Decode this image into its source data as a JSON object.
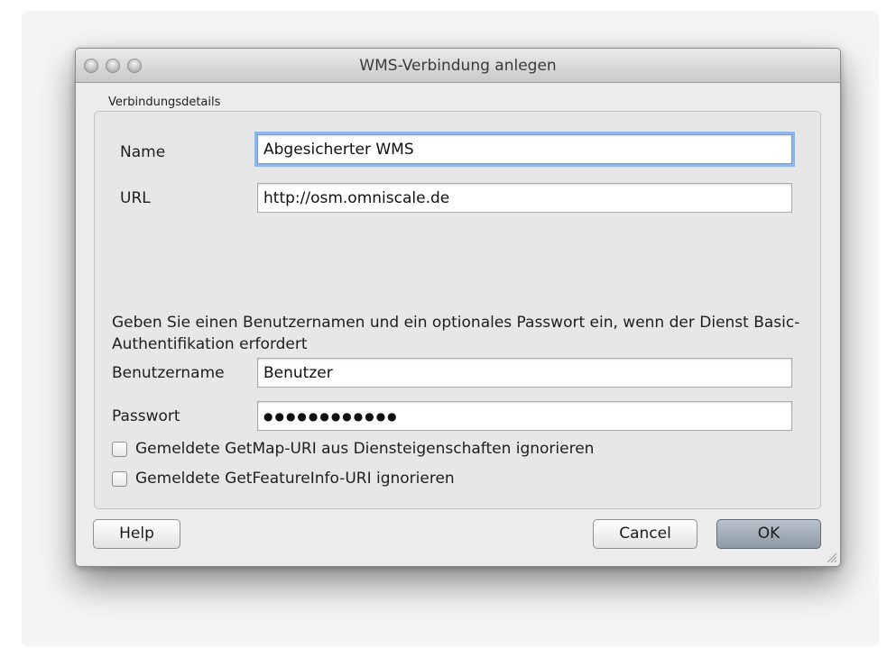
{
  "window": {
    "title": "WMS-Verbindung anlegen"
  },
  "group": {
    "label": "Verbindungsdetails"
  },
  "fields": {
    "name": {
      "label": "Name",
      "value": "Abgesicherter WMS"
    },
    "url": {
      "label": "URL",
      "value": "http://osm.omniscale.de"
    },
    "username": {
      "label": "Benutzername",
      "value": "Benutzer"
    },
    "password": {
      "label": "Passwort",
      "value": "●●●●●●●●●●●●"
    }
  },
  "info_text": "Geben Sie einen Benutzernamen und ein optionales Passwort ein, wenn der Dienst Basic-Authentifikation erfordert",
  "checkboxes": [
    {
      "label": "Gemeldete GetMap-URI aus Diensteigenschaften ignorieren",
      "checked": false
    },
    {
      "label": "Gemeldete GetFeatureInfo-URI ignorieren",
      "checked": false
    }
  ],
  "buttons": {
    "help": "Help",
    "cancel": "Cancel",
    "ok": "OK"
  },
  "colors": {
    "focus_ring": "#8fb6e8",
    "default_button": "#9aa5b0"
  }
}
